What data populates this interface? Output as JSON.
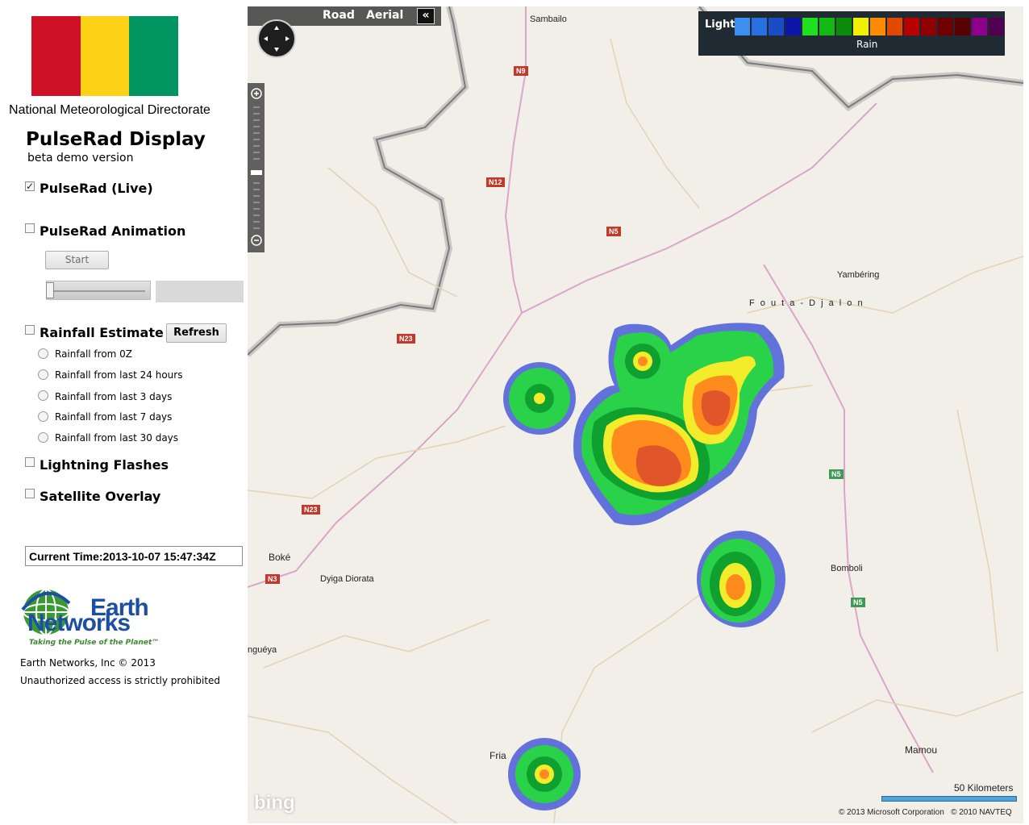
{
  "sidebar": {
    "flag_colors": [
      "#ce1126",
      "#fcd116",
      "#009460"
    ],
    "org_name": "National Meteorological Directorate",
    "title": "PulseRad Display",
    "subtitle": "beta demo version",
    "live": {
      "label": "PulseRad (Live)",
      "checked": true,
      "check_glyph": "✓"
    },
    "animation": {
      "label": "PulseRad Animation",
      "checked": false,
      "start_label": "Start",
      "slider_fraction": 0
    },
    "rainfall": {
      "label": "Rainfall Estimate",
      "checked": false,
      "refresh_label": "Refresh",
      "options": [
        "Rainfall from 0Z",
        "Rainfall from last 24 hours",
        "Rainfall from last 3 days",
        "Rainfall from last 7 days",
        "Rainfall from last 30 days"
      ]
    },
    "lightning": {
      "label": "Lightning Flashes",
      "checked": false
    },
    "satellite": {
      "label": "Satellite Overlay",
      "checked": false
    },
    "current_time": "Current Time:2013-10-07 15:47:34Z",
    "logo": {
      "line1": "Earth",
      "line2": "Networks",
      "tagline": "Taking the Pulse of the Planet™",
      "icon": "globe-icon"
    },
    "copyright": "Earth Networks, Inc © 2013",
    "notice": "Unauthorized access is strictly prohibited"
  },
  "map": {
    "view_buttons": {
      "road": "Road",
      "aerial": "Aerial",
      "collapse": "«"
    },
    "legend": {
      "label_light": "Light",
      "label_rain": "Rain",
      "colors": [
        "#3a8ff0",
        "#2a6fe0",
        "#1a4cc8",
        "#0c16a8",
        "#1ee01e",
        "#14b814",
        "#0a8c0a",
        "#f0f000",
        "#ff8c00",
        "#e04a00",
        "#b80000",
        "#900000",
        "#700000",
        "#5a0000",
        "#8c008c",
        "#500050"
      ]
    },
    "towns": [
      "Sambailo",
      "Yambéring",
      "F o u t a - D j a l o n",
      "Boké",
      "Dyiga Diorata",
      "Bomboli",
      "nguéya",
      "Fria",
      "Mamou"
    ],
    "roads": [
      "N9",
      "N12",
      "N5",
      "N23",
      "N23",
      "N5",
      "N3",
      "N5"
    ],
    "scale_label": "50 Kilometers",
    "provider": "bing",
    "attribution": "© 2013 Microsoft Corporation   © 2010 NAVTEQ"
  }
}
